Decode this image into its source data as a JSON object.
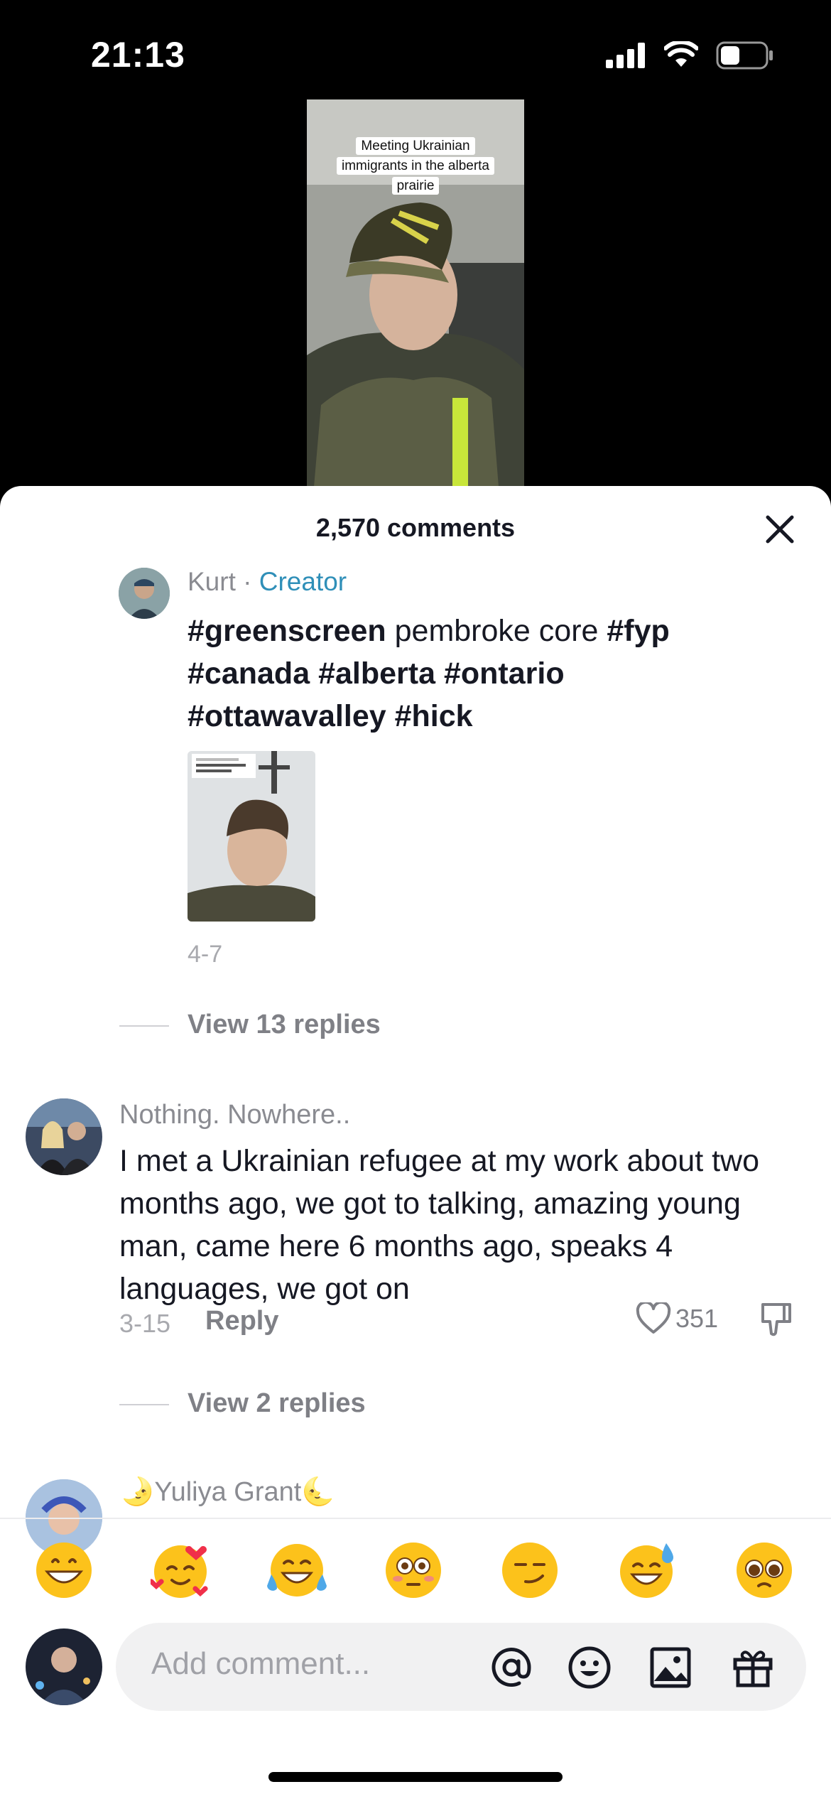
{
  "status_bar": {
    "time": "21:13"
  },
  "video": {
    "caption": "Meeting Ukrainian immigrants in the alberta prairie"
  },
  "sheet": {
    "title": "2,570 comments"
  },
  "creator_comment": {
    "username": "Kurt",
    "separator": " · ",
    "badge": "Creator",
    "text_parts": [
      {
        "t": "#greenscreen",
        "tag": true
      },
      {
        "t": " pembroke core ",
        "tag": false
      },
      {
        "t": "#fyp",
        "tag": true
      },
      {
        "t": " ",
        "tag": false
      },
      {
        "t": "#canada",
        "tag": true
      },
      {
        "t": " ",
        "tag": false
      },
      {
        "t": "#alberta",
        "tag": true
      },
      {
        "t": " ",
        "tag": false
      },
      {
        "t": "#ontario",
        "tag": true
      },
      {
        "t": " ",
        "tag": false
      },
      {
        "t": "#ottawavalley",
        "tag": true
      },
      {
        "t": " ",
        "tag": false
      },
      {
        "t": "#hick",
        "tag": true
      }
    ],
    "date": "4-7",
    "view_replies": "View 13 replies"
  },
  "comment2": {
    "username": "Nothing. Nowhere..",
    "text": "I met a Ukrainian refugee at my work about two months ago, we got to talking, amazing young man, came here 6 months ago, speaks 4 languages, we got on",
    "date": "3-15",
    "reply": "Reply",
    "likes": "351",
    "view_replies": "View 2 replies"
  },
  "comment3": {
    "username": "🌛Yuliya Grant🌜"
  },
  "emoji_bar": [
    "grinning",
    "smiling-hearts",
    "tears-of-joy",
    "flushed",
    "smirk",
    "sweat-smile",
    "pleading"
  ],
  "input": {
    "placeholder": "Add comment..."
  },
  "colors": {
    "creator_badge": "#2f8fb8",
    "muted": "#8a8b91",
    "background_top": "#000000"
  }
}
